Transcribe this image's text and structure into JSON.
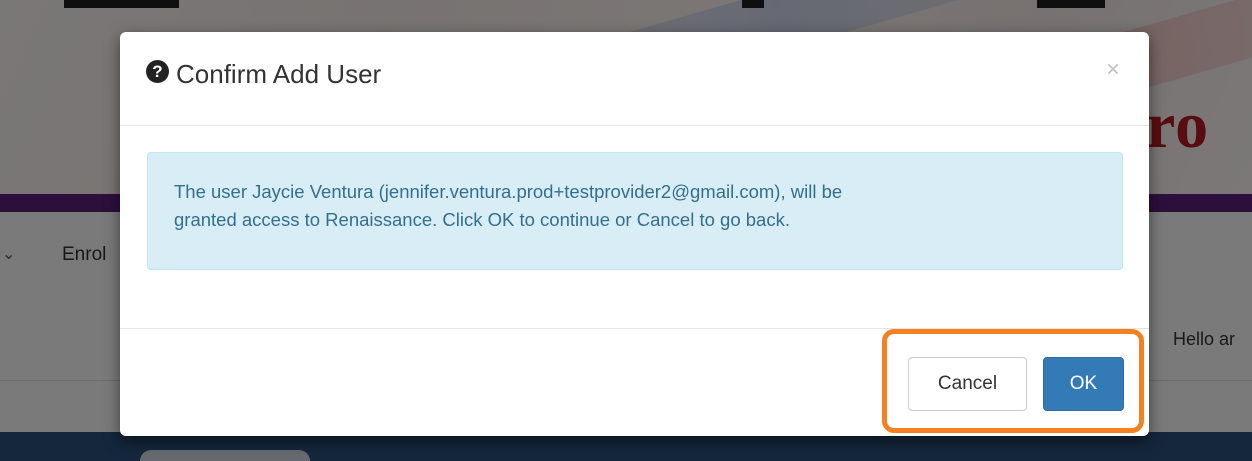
{
  "background": {
    "brand_text": "ro",
    "nav_item": "Enrol",
    "greeting": "Hello ar"
  },
  "modal": {
    "icon": "question-circle-icon",
    "title": "Confirm Add User",
    "close_glyph": "×",
    "message_line1": "The user Jaycie Ventura (jennifer.ventura.prod+testprovider2@gmail.com), will be",
    "message_line2": "granted access to Renaissance. Click OK to continue or Cancel to go back.",
    "buttons": {
      "cancel_label": "Cancel",
      "ok_label": "OK"
    }
  },
  "colors": {
    "primary_button": "#337ab7",
    "alert_background": "#d9edf7",
    "alert_text": "#31708f",
    "highlight": "#f4801f",
    "brand_purple": "#5a1f79",
    "brand_red": "#b0191f"
  }
}
